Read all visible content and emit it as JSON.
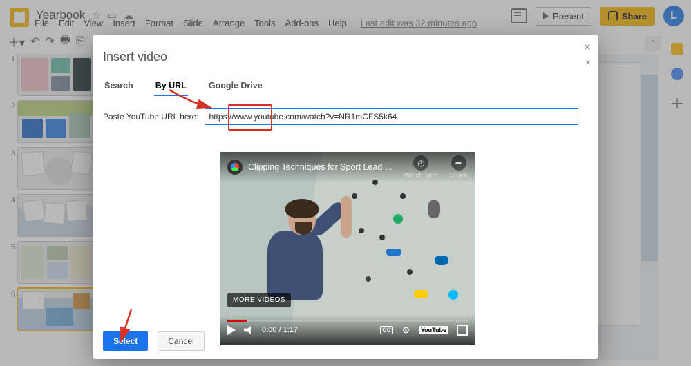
{
  "header": {
    "doc_title": "Yearbook",
    "menus": [
      "File",
      "Edit",
      "View",
      "Insert",
      "Format",
      "Slide",
      "Arrange",
      "Tools",
      "Add-ons",
      "Help"
    ],
    "last_edit": "Last edit was 32 minutes ago",
    "present_label": "Present",
    "share_label": "Share",
    "avatar_letter": "L"
  },
  "thumbs": [
    1,
    2,
    3,
    4,
    5,
    6
  ],
  "active_thumb": 6,
  "dialog": {
    "title": "Insert video",
    "tabs": {
      "search": "Search",
      "by_url": "By URL",
      "drive": "Google Drive"
    },
    "active_tab": "by_url",
    "url_label": "Paste YouTube URL here:",
    "url_value": "https://www.youtube.com/watch?v=NR1mCFS5k64",
    "select_label": "Select",
    "cancel_label": "Cancel"
  },
  "video": {
    "title": "Clipping Techniques for Sport Lead ...",
    "watch_later": "Watch later",
    "share": "Share",
    "more": "MORE VIDEOS",
    "time": "0:00 / 1:17",
    "cc": "CC",
    "youtube": "YouTube"
  }
}
